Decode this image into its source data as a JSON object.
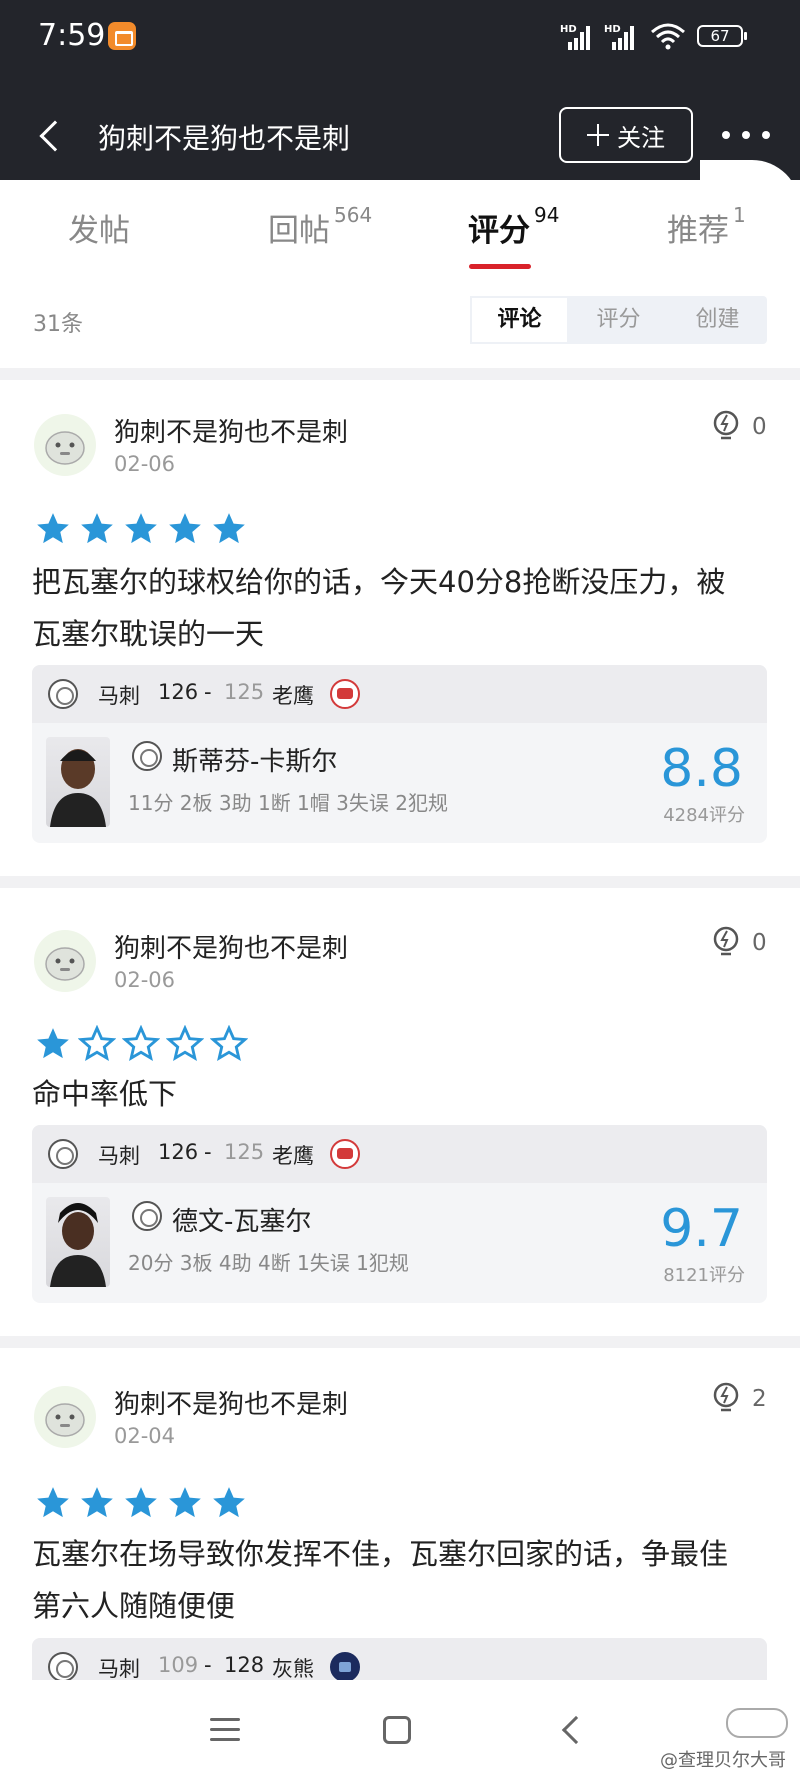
{
  "status_bar": {
    "time": "7:59",
    "network_1": "HD",
    "network_2": "HD",
    "battery": "67"
  },
  "header": {
    "title": "狗刺不是狗也不是刺",
    "follow_label": "关注"
  },
  "tabs": [
    {
      "label": "发帖",
      "count": ""
    },
    {
      "label": "回帖",
      "count": "564"
    },
    {
      "label": "评分",
      "count": "94"
    },
    {
      "label": "推荐",
      "count": "1"
    }
  ],
  "list_count": "31条",
  "segment": [
    "评论",
    "评分",
    "创建"
  ],
  "posts": [
    {
      "user": "狗刺不是狗也不是刺",
      "date": "02-06",
      "likes": "0",
      "stars": 5,
      "comment": "把瓦塞尔的球权给你的话，今天40分8抢断没压力，被瓦塞尔耽误的一天",
      "team_a": "马刺",
      "score_a": "126",
      "dash": "-",
      "score_b": "125",
      "team_b": "老鹰",
      "player": "斯蒂芬-卡斯尔",
      "stats": "11分 2板 3助 1断 1帽 3失误 2犯规",
      "rating": "8.8",
      "votes": "4284评分"
    },
    {
      "user": "狗刺不是狗也不是刺",
      "date": "02-06",
      "likes": "0",
      "stars": 1,
      "comment": "命中率低下",
      "team_a": "马刺",
      "score_a": "126",
      "dash": "-",
      "score_b": "125",
      "team_b": "老鹰",
      "player": "德文-瓦塞尔",
      "stats": "20分 3板 4助 4断 1失误 1犯规",
      "rating": "9.7",
      "votes": "8121评分"
    },
    {
      "user": "狗刺不是狗也不是刺",
      "date": "02-04",
      "likes": "2",
      "stars": 5,
      "comment": "瓦塞尔在场导致你发挥不佳，瓦塞尔回家的话，争最佳第六人随随便便",
      "team_a": "马刺",
      "score_a": "109",
      "dash": "-",
      "score_b": "128",
      "team_b": "灰熊"
    }
  ],
  "watermark": "@查理贝尔大哥",
  "colors": {
    "header_bg": "#23252b",
    "accent_red": "#d9222a",
    "star_blue": "#2a96d8",
    "rating_blue": "#2a96d8"
  },
  "icons": [
    "back-arrow-icon",
    "plus-icon",
    "more-icon",
    "like-bulb-icon",
    "star-icon",
    "team-logo-icon",
    "menu-icon",
    "home-icon",
    "nav-back-icon"
  ]
}
